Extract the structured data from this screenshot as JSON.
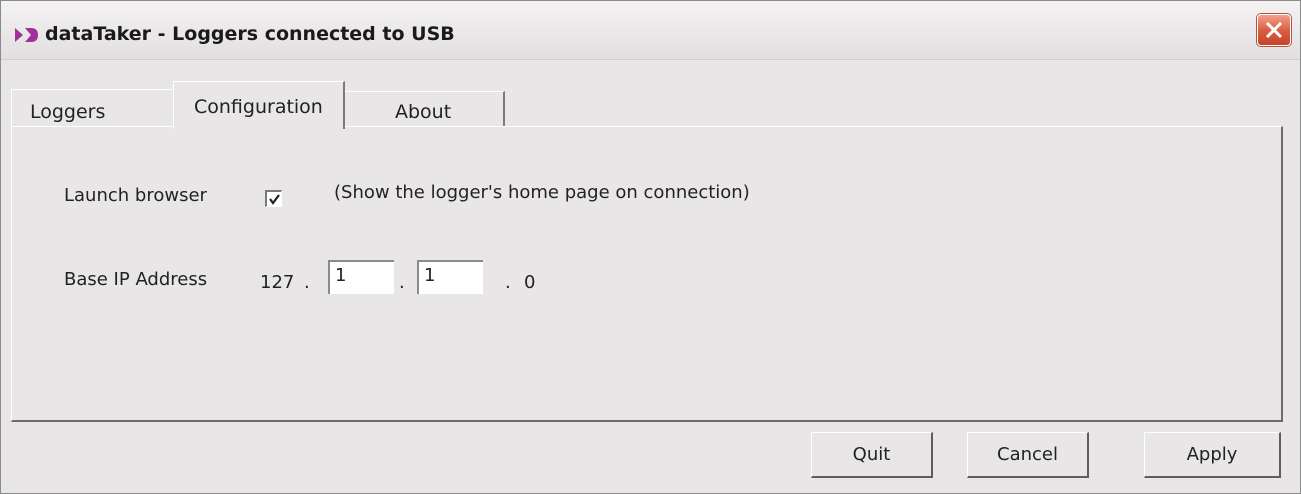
{
  "window": {
    "title": "dataTaker - Loggers connected to USB",
    "app_icon": "datataker-logo-icon",
    "close_icon": "close-x-icon"
  },
  "tabs": [
    {
      "label": "Loggers",
      "selected": false
    },
    {
      "label": "Configuration",
      "selected": true
    },
    {
      "label": "About",
      "selected": false
    }
  ],
  "config": {
    "launch_browser_label": "Launch browser",
    "launch_browser_checked": true,
    "launch_browser_hint": "(Show the logger's home page on connection)",
    "base_ip_label": "Base IP Address",
    "ip_octet_1": "127",
    "ip_dot": ".",
    "ip_octet_2": "1",
    "ip_octet_3": "1",
    "ip_octet_4": "0"
  },
  "buttons": {
    "quit": "Quit",
    "cancel": "Cancel",
    "apply": "Apply"
  },
  "colors": {
    "close_button": "#d95a3d",
    "app_icon": "#a0309a",
    "window_bg": "#e9e6e8"
  }
}
